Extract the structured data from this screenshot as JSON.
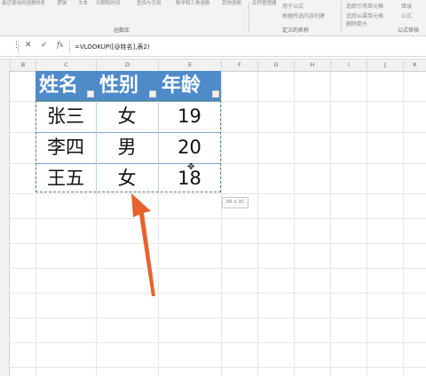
{
  "ribbon": {
    "top_items": [
      "最近使用的函数",
      "财务",
      "逻辑",
      "文本",
      "日期和时间",
      "查找与引用",
      "数学和三角函数",
      "其他函数",
      "名称管理器",
      "用于公式",
      "根据所选内容创建",
      "追踪从属单元格",
      "删除箭头",
      "公式"
    ],
    "right_items": [
      "追踪引用单元格",
      "错误",
      "公式求值"
    ],
    "groups": {
      "function_library": "函数库",
      "defined_names": "定义的名称",
      "formula_auditing": "公式审核"
    }
  },
  "formula_bar": {
    "cancel_icon": "x-icon",
    "confirm_icon": "check-icon",
    "fx_label": "fx",
    "formula": "=VLOOKUP([@姓名],表2)"
  },
  "columns": [
    "B",
    "C",
    "D",
    "E",
    "F",
    "G",
    "H",
    "I",
    "J",
    "K"
  ],
  "table": {
    "headers": [
      "姓名",
      "性别",
      "年龄"
    ],
    "rows": [
      [
        "张三",
        "女",
        "19"
      ],
      [
        "李四",
        "男",
        "20"
      ],
      [
        "王五",
        "女",
        "18"
      ]
    ],
    "header_color": "#4f8bc9",
    "selection_tooltip": "3R x 3C"
  },
  "annotation": {
    "arrow_color": "#e8622d"
  }
}
